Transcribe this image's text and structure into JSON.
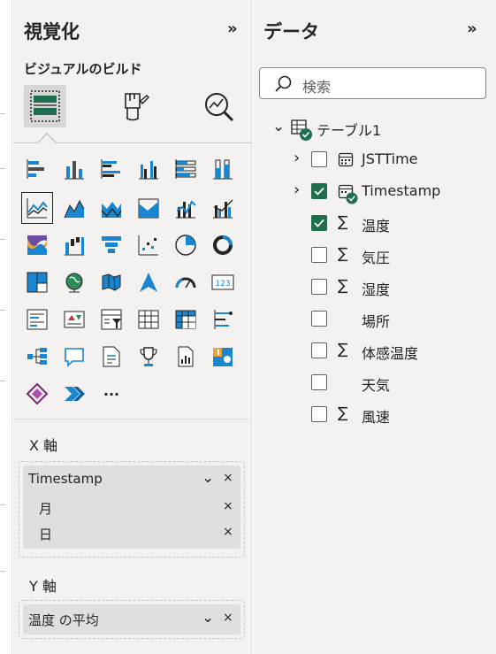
{
  "viz_pane": {
    "title": "視覚化",
    "collapse": "»",
    "subtitle": "ビジュアルのビルド",
    "mode_buttons": [
      "build-visual",
      "format-visual",
      "analytics"
    ],
    "x_axis": {
      "label": "X 軸",
      "field": "Timestamp",
      "hierarchy": [
        "月",
        "日"
      ]
    },
    "y_axis": {
      "label": "Y 軸",
      "field": "温度 の平均"
    },
    "more": "···",
    "chevron": "⌄",
    "remove": "×"
  },
  "data_pane": {
    "title": "データ",
    "collapse": "»",
    "search_placeholder": "検索",
    "table": "テーブル1",
    "fields": [
      {
        "name": "JSTTime",
        "type": "date",
        "checked": false,
        "expandable": true
      },
      {
        "name": "Timestamp",
        "type": "date",
        "checked": true,
        "expandable": true
      },
      {
        "name": "温度",
        "type": "sum",
        "checked": true,
        "expandable": false
      },
      {
        "name": "気圧",
        "type": "sum",
        "checked": false,
        "expandable": false
      },
      {
        "name": "湿度",
        "type": "sum",
        "checked": false,
        "expandable": false
      },
      {
        "name": "場所",
        "type": "text",
        "checked": false,
        "expandable": false
      },
      {
        "name": "体感温度",
        "type": "sum",
        "checked": false,
        "expandable": false
      },
      {
        "name": "天気",
        "type": "text",
        "checked": false,
        "expandable": false
      },
      {
        "name": "風速",
        "type": "sum",
        "checked": false,
        "expandable": false
      }
    ],
    "sigma": "∑",
    "chevron_right": "›",
    "chevron_down": "⌄"
  },
  "colors": {
    "accent_green": "#1f6f4f",
    "viz_blue": "#1a86d0",
    "pane_bg": "#f3f2f1"
  }
}
